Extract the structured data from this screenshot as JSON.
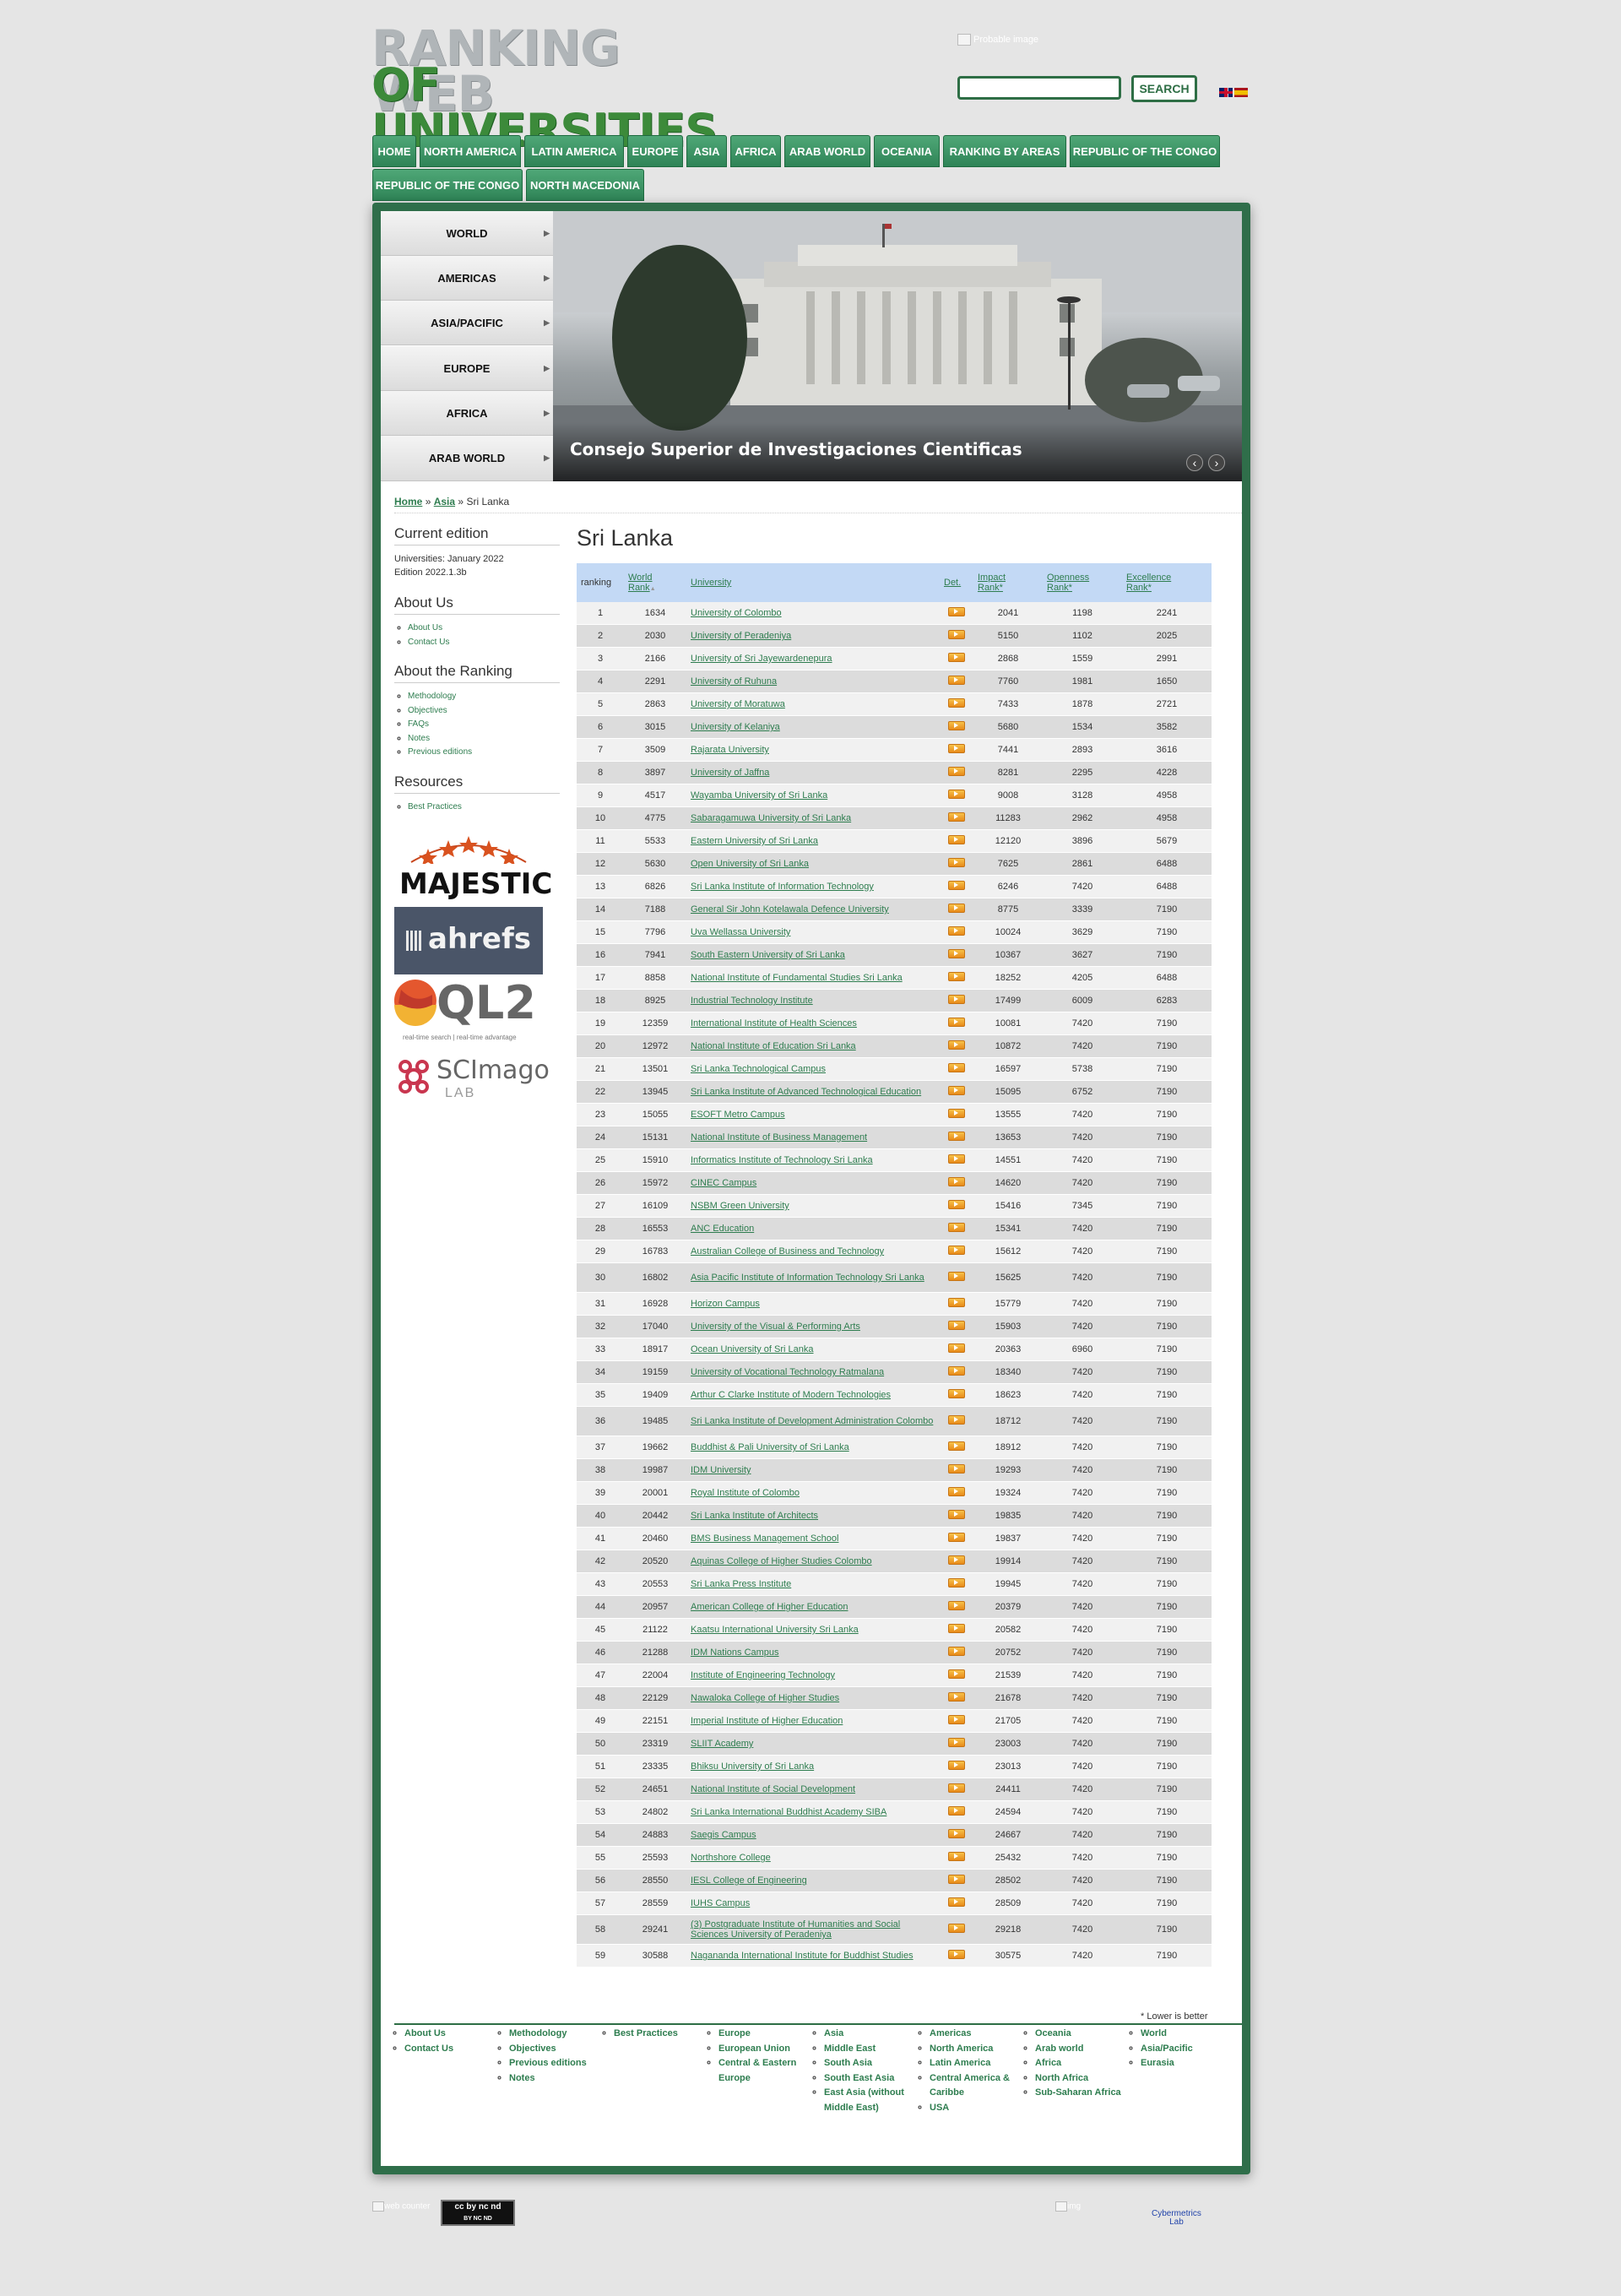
{
  "logo": {
    "line1": "RANKING WEB",
    "line2": "OF UNIVERSITIES"
  },
  "header": {
    "probable_image": "Probable image",
    "search_button": "SEARCH",
    "search_placeholder": "",
    "lang_en": "English",
    "lang_es": "Español"
  },
  "nav": [
    "HOME",
    "NORTH AMERICA",
    "LATIN AMERICA",
    "EUROPE",
    "ASIA",
    "AFRICA",
    "ARAB WORLD",
    "OCEANIA",
    "RANKING BY AREAS",
    "REPUBLIC OF THE CONGO",
    "REPUBLIC OF THE CONGO",
    "NORTH MACEDONIA"
  ],
  "region_menu": [
    "WORLD",
    "AMERICAS",
    "ASIA/PACIFIC",
    "EUROPE",
    "AFRICA",
    "ARAB WORLD"
  ],
  "banner": {
    "caption": "Consejo Superior de Investigaciones Cientificas",
    "prev": "‹",
    "next": "›"
  },
  "breadcrumb": {
    "home": "Home",
    "sep1": "»",
    "asia": "Asia",
    "sep2": "»",
    "current": "Sri Lanka"
  },
  "sidebar": {
    "edition_title": "Current edition",
    "edition_line1": "Universities: January 2022",
    "edition_line2": "Edition 2022.1.3b",
    "about_title": "About Us",
    "about_links": [
      "About Us",
      "Contact Us"
    ],
    "ranking_title": "About the Ranking",
    "ranking_links": [
      "Methodology",
      "Objectives",
      "FAQs",
      "Notes",
      "Previous editions"
    ],
    "resources_title": "Resources",
    "resources_links": [
      "Best Practices"
    ],
    "sponsors": {
      "majestic": "MAJESTIC",
      "ahrefs": "ahrefs",
      "ql2": "QL2",
      "ql2_tag": "real-time search | real-time advantage",
      "scimago": "SCImago",
      "scimago_lab": "LAB"
    }
  },
  "page_title": "Sri Lanka",
  "table": {
    "headers": {
      "ranking": "ranking",
      "world": "World",
      "world2": "Rank",
      "world_sort": "▲",
      "university": "University",
      "det": "Det.",
      "impact": "Impact",
      "impact2": "Rank*",
      "openness": "Openness",
      "openness2": "Rank*",
      "excellence": "Excellence",
      "excellence2": "Rank*"
    },
    "rows": [
      [
        "1",
        "1634",
        "University of Colombo",
        "2041",
        "1198",
        "2241"
      ],
      [
        "2",
        "2030",
        "University of Peradeniya",
        "5150",
        "1102",
        "2025"
      ],
      [
        "3",
        "2166",
        "University of Sri Jayewardenepura",
        "2868",
        "1559",
        "2991"
      ],
      [
        "4",
        "2291",
        "University of Ruhuna",
        "7760",
        "1981",
        "1650"
      ],
      [
        "5",
        "2863",
        "University of Moratuwa",
        "7433",
        "1878",
        "2721"
      ],
      [
        "6",
        "3015",
        "University of Kelaniya",
        "5680",
        "1534",
        "3582"
      ],
      [
        "7",
        "3509",
        "Rajarata University",
        "7441",
        "2893",
        "3616"
      ],
      [
        "8",
        "3897",
        "University of Jaffna",
        "8281",
        "2295",
        "4228"
      ],
      [
        "9",
        "4517",
        "Wayamba University of Sri Lanka",
        "9008",
        "3128",
        "4958"
      ],
      [
        "10",
        "4775",
        "Sabaragamuwa University of Sri Lanka",
        "11283",
        "2962",
        "4958"
      ],
      [
        "11",
        "5533",
        "Eastern University of Sri Lanka",
        "12120",
        "3896",
        "5679"
      ],
      [
        "12",
        "5630",
        "Open University of Sri Lanka",
        "7625",
        "2861",
        "6488"
      ],
      [
        "13",
        "6826",
        "Sri Lanka Institute of Information Technology",
        "6246",
        "7420",
        "6488"
      ],
      [
        "14",
        "7188",
        "General Sir John Kotelawala Defence University",
        "8775",
        "3339",
        "7190"
      ],
      [
        "15",
        "7796",
        "Uva Wellassa University",
        "10024",
        "3629",
        "7190"
      ],
      [
        "16",
        "7941",
        "South Eastern University of Sri Lanka",
        "10367",
        "3627",
        "7190"
      ],
      [
        "17",
        "8858",
        "National Institute of Fundamental Studies Sri Lanka",
        "18252",
        "4205",
        "6488"
      ],
      [
        "18",
        "8925",
        "Industrial Technology Institute",
        "17499",
        "6009",
        "6283"
      ],
      [
        "19",
        "12359",
        "International Institute of Health Sciences",
        "10081",
        "7420",
        "7190"
      ],
      [
        "20",
        "12972",
        "National Institute of Education Sri Lanka",
        "10872",
        "7420",
        "7190"
      ],
      [
        "21",
        "13501",
        "Sri Lanka Technological Campus",
        "16597",
        "5738",
        "7190"
      ],
      [
        "22",
        "13945",
        "Sri Lanka Institute of Advanced Technological Education",
        "15095",
        "6752",
        "7190"
      ],
      [
        "23",
        "15055",
        "ESOFT Metro Campus",
        "13555",
        "7420",
        "7190"
      ],
      [
        "24",
        "15131",
        "National Institute of Business Management",
        "13653",
        "7420",
        "7190"
      ],
      [
        "25",
        "15910",
        "Informatics Institute of Technology Sri Lanka",
        "14551",
        "7420",
        "7190"
      ],
      [
        "26",
        "15972",
        "CINEC Campus",
        "14620",
        "7420",
        "7190"
      ],
      [
        "27",
        "16109",
        "NSBM Green University",
        "15416",
        "7345",
        "7190"
      ],
      [
        "28",
        "16553",
        "ANC Education",
        "15341",
        "7420",
        "7190"
      ],
      [
        "29",
        "16783",
        "Australian College of Business and Technology",
        "15612",
        "7420",
        "7190"
      ],
      [
        "30",
        "16802",
        "Asia Pacific Institute of Information Technology Sri Lanka",
        "15625",
        "7420",
        "7190"
      ],
      [
        "31",
        "16928",
        "Horizon Campus",
        "15779",
        "7420",
        "7190"
      ],
      [
        "32",
        "17040",
        "University of the Visual & Performing Arts",
        "15903",
        "7420",
        "7190"
      ],
      [
        "33",
        "18917",
        "Ocean University of Sri Lanka",
        "20363",
        "6960",
        "7190"
      ],
      [
        "34",
        "19159",
        "University of Vocational Technology Ratmalana",
        "18340",
        "7420",
        "7190"
      ],
      [
        "35",
        "19409",
        "Arthur C Clarke Institute of Modern Technologies",
        "18623",
        "7420",
        "7190"
      ],
      [
        "36",
        "19485",
        "Sri Lanka Institute of Development Administration Colombo",
        "18712",
        "7420",
        "7190"
      ],
      [
        "37",
        "19662",
        "Buddhist & Pali University of Sri Lanka",
        "18912",
        "7420",
        "7190"
      ],
      [
        "38",
        "19987",
        "IDM University",
        "19293",
        "7420",
        "7190"
      ],
      [
        "39",
        "20001",
        "Royal Institute of Colombo",
        "19324",
        "7420",
        "7190"
      ],
      [
        "40",
        "20442",
        "Sri Lanka Institute of Architects",
        "19835",
        "7420",
        "7190"
      ],
      [
        "41",
        "20460",
        "BMS Business Management School",
        "19837",
        "7420",
        "7190"
      ],
      [
        "42",
        "20520",
        "Aquinas College of Higher Studies Colombo",
        "19914",
        "7420",
        "7190"
      ],
      [
        "43",
        "20553",
        "Sri Lanka Press Institute",
        "19945",
        "7420",
        "7190"
      ],
      [
        "44",
        "20957",
        "American College of Higher Education",
        "20379",
        "7420",
        "7190"
      ],
      [
        "45",
        "21122",
        "Kaatsu International University Sri Lanka",
        "20582",
        "7420",
        "7190"
      ],
      [
        "46",
        "21288",
        "IDM Nations Campus",
        "20752",
        "7420",
        "7190"
      ],
      [
        "47",
        "22004",
        "Institute of Engineering Technology",
        "21539",
        "7420",
        "7190"
      ],
      [
        "48",
        "22129",
        "Nawaloka College of Higher Studies",
        "21678",
        "7420",
        "7190"
      ],
      [
        "49",
        "22151",
        "Imperial Institute of Higher Education",
        "21705",
        "7420",
        "7190"
      ],
      [
        "50",
        "23319",
        "SLIIT Academy",
        "23003",
        "7420",
        "7190"
      ],
      [
        "51",
        "23335",
        "Bhiksu University of Sri Lanka",
        "23013",
        "7420",
        "7190"
      ],
      [
        "52",
        "24651",
        "National Institute of Social Development",
        "24411",
        "7420",
        "7190"
      ],
      [
        "53",
        "24802",
        "Sri Lanka International Buddhist Academy SIBA",
        "24594",
        "7420",
        "7190"
      ],
      [
        "54",
        "24883",
        "Saegis Campus",
        "24667",
        "7420",
        "7190"
      ],
      [
        "55",
        "25593",
        "Northshore College",
        "25432",
        "7420",
        "7190"
      ],
      [
        "56",
        "28550",
        "IESL College of Engineering",
        "28502",
        "7420",
        "7190"
      ],
      [
        "57",
        "28559",
        "IUHS Campus",
        "28509",
        "7420",
        "7190"
      ],
      [
        "58",
        "29241",
        "(3) Postgraduate Institute of Humanities and Social Sciences University of Peradeniya",
        "29218",
        "7420",
        "7190"
      ],
      [
        "59",
        "30588",
        "Nagananda International Institute for Buddhist Studies",
        "30575",
        "7420",
        "7190"
      ]
    ]
  },
  "lower_note": "* Lower is better",
  "footer": [
    [
      "About Us",
      "Contact Us"
    ],
    [
      "Methodology",
      "Objectives",
      "Previous editions",
      "Notes"
    ],
    [
      "Best Practices"
    ],
    [
      "Europe",
      "European Union",
      "Central & Eastern Europe"
    ],
    [
      "Asia",
      "Middle East",
      "South Asia",
      "South East Asia",
      "East Asia (without Middle East)"
    ],
    [
      "Americas",
      "North America",
      "Latin America",
      "Central America & Caribbe",
      "USA"
    ],
    [
      "Oceania",
      "Arab world",
      "Africa",
      "North Africa",
      "Sub-Saharan Africa"
    ],
    [
      "World",
      "Asia/Pacific",
      "Eurasia"
    ]
  ],
  "bottom": {
    "web_counter": "web counter",
    "cc": "cc by nc nd",
    "cc2": "BY  NC  ND",
    "img": "img",
    "cybermetrics": "Cybermetrics",
    "cyber_lab": "Lab"
  },
  "colors": {
    "brand_green": "#2f6e4a",
    "link": "#2e7d4f",
    "header_blue": "#c3d9f5"
  }
}
